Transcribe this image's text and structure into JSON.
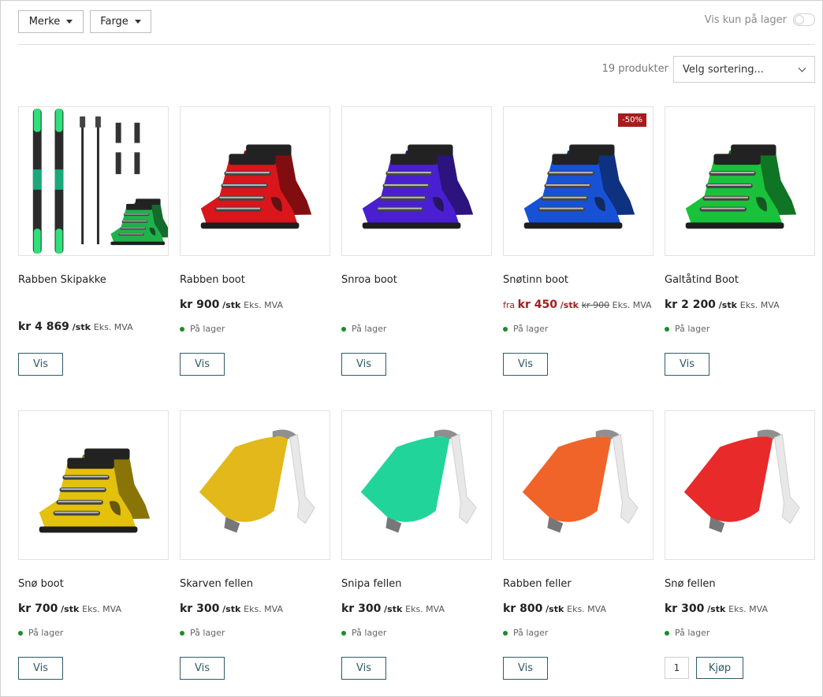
{
  "filters": {
    "brand": "Merke",
    "color": "Farge",
    "stock_only": "Vis kun på lager"
  },
  "toolbar": {
    "count": "19 produkter",
    "sort_placeholder": "Velg sortering..."
  },
  "colors": {
    "accent": "#2f5b67",
    "sale": "#a61c1c",
    "in_stock": "#1f8a2b"
  },
  "products": [
    {
      "name": "Rabben Skipakke",
      "price": "kr 4 869",
      "unit": "/stk",
      "vat": "Eks. MVA",
      "stock": "",
      "action": "Vis",
      "image": "ski-package",
      "color": "#1fb24a"
    },
    {
      "name": "Rabben boot",
      "price": "kr 900",
      "unit": "/stk",
      "vat": "Eks. MVA",
      "stock": "På lager",
      "action": "Vis",
      "image": "ski-boot",
      "color": "#d9161b"
    },
    {
      "name": "Snroa boot",
      "price": "",
      "unit": "",
      "vat": "",
      "stock": "På lager",
      "action": "Vis",
      "image": "ski-boot",
      "color": "#4a1fd1"
    },
    {
      "name": "Snøtinn boot",
      "from": "fra",
      "price": "kr 450",
      "unit": "/stk",
      "old_price": "kr 900",
      "vat": "Eks. MVA",
      "badge": "-50%",
      "stock": "På lager",
      "action": "Vis",
      "image": "ski-boot",
      "color": "#1752d6"
    },
    {
      "name": "Galtåtind Boot",
      "price": "kr 2 200",
      "unit": "/stk",
      "vat": "Eks. MVA",
      "stock": "På lager",
      "action": "Vis",
      "image": "ski-boot",
      "color": "#19c23a"
    },
    {
      "name": "Snø boot",
      "price": "kr 700",
      "unit": "/stk",
      "vat": "Eks. MVA",
      "stock": "På lager",
      "action": "Vis",
      "image": "ski-boot",
      "color": "#e3c10c"
    },
    {
      "name": "Skarven fellen",
      "price": "kr 300",
      "unit": "/stk",
      "vat": "Eks. MVA",
      "stock": "På lager",
      "action": "Vis",
      "image": "climbing-skin",
      "color": "#e2b81a"
    },
    {
      "name": "Snipa fellen",
      "price": "kr 300",
      "unit": "/stk",
      "vat": "Eks. MVA",
      "stock": "På lager",
      "action": "Vis",
      "image": "climbing-skin",
      "color": "#21d59a"
    },
    {
      "name": "Rabben feller",
      "price": "kr 800",
      "unit": "/stk",
      "vat": "Eks. MVA",
      "stock": "På lager",
      "action": "Vis",
      "image": "climbing-skin",
      "color": "#f0642a"
    },
    {
      "name": "Snø fellen",
      "price": "kr 300",
      "unit": "/stk",
      "vat": "Eks. MVA",
      "stock": "På lager",
      "action": "Kjøp",
      "quantity": "1",
      "image": "climbing-skin",
      "color": "#e82a2a"
    }
  ]
}
